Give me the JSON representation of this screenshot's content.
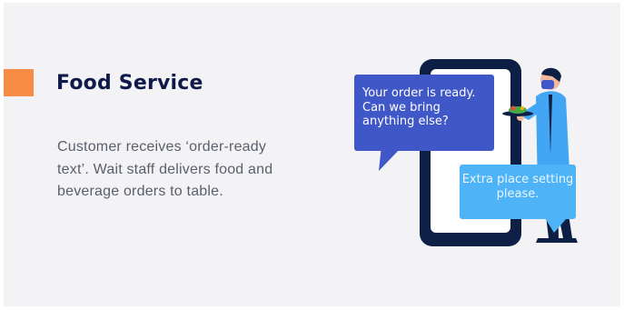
{
  "section": {
    "title": "Food Service",
    "description": "Customer receives ‘order-ready text’. Wait staff delivers food and beverage orders to table."
  },
  "illustration": {
    "customer_message": "Your order is ready. Can we bring anything else?",
    "reply_message": "Extra place setting please.",
    "colors": {
      "accent": "#f78c45",
      "phone": "#0e1f45",
      "bubble_dark": "#3f57c7",
      "bubble_light": "#4fb3f7",
      "shirt": "#42a6f5"
    }
  }
}
